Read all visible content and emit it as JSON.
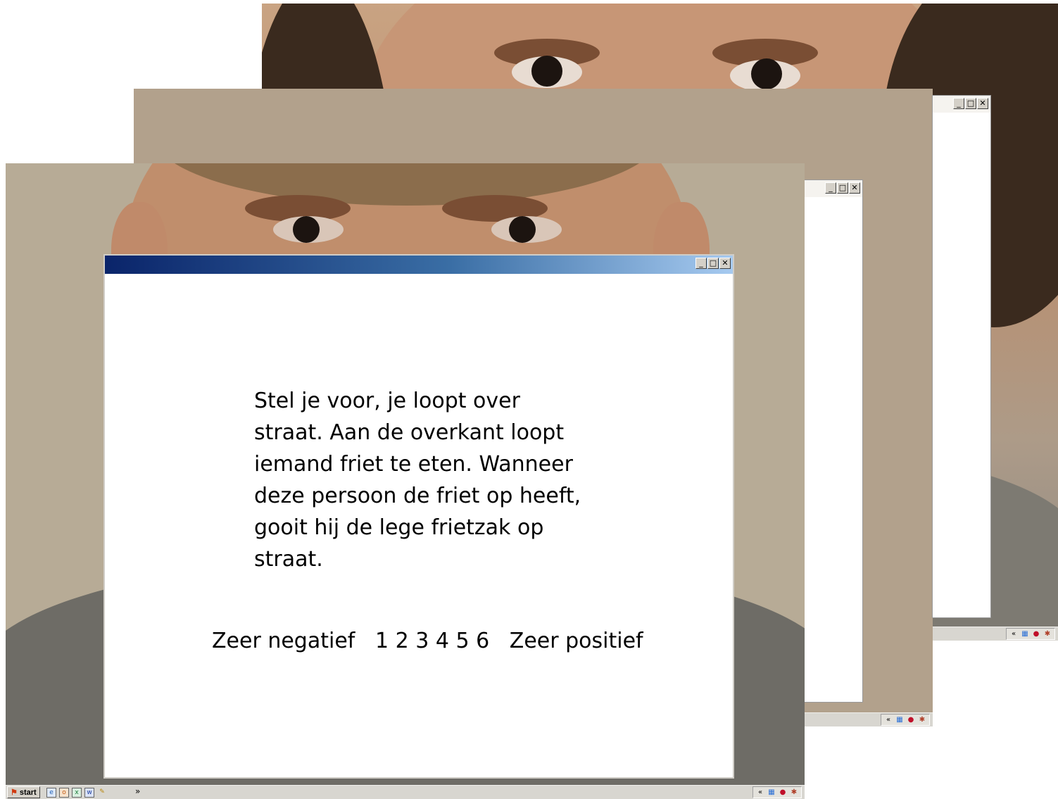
{
  "front_window": {
    "prompt": "Stel je voor, je loopt over straat. Aan de overkant loopt iemand friet te eten. Wanneer deze persoon de friet op heeft, gooit hij de lege frietzak op straat.",
    "scale": {
      "left_label": "Zeer negatief",
      "numbers": "1 2 3 4 5 6",
      "right_label": "Zeer positief"
    }
  },
  "window_controls": {
    "minimize": "_",
    "maximize": "□",
    "close": "✕"
  },
  "taskbar": {
    "start_label": "start",
    "overflow": "»",
    "tray_expand": "«"
  },
  "icons": {
    "start": "windows-flag-icon",
    "quick_launch": [
      "ie-icon",
      "outlook-icon",
      "excel-icon",
      "word-icon",
      "pen-icon"
    ],
    "tray": [
      "network-icon",
      "antivirus-icon",
      "security-icon"
    ]
  }
}
